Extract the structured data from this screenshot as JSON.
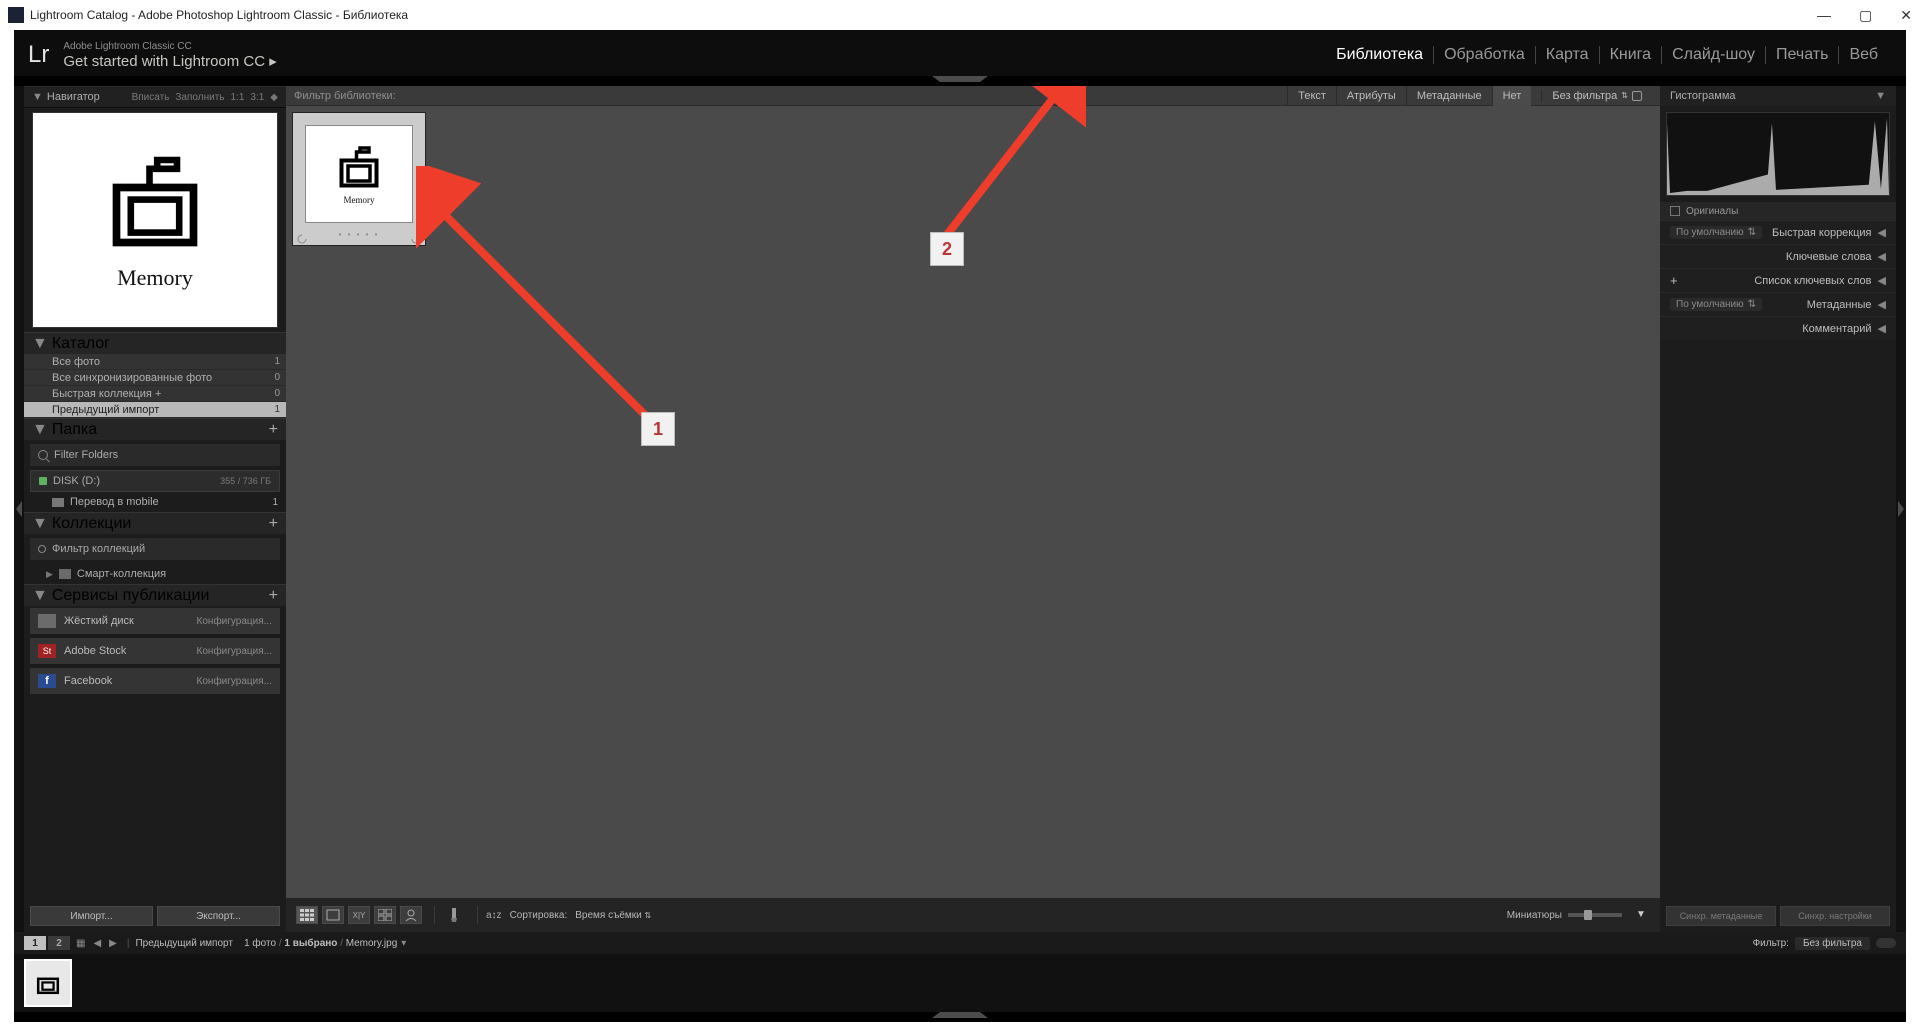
{
  "window": {
    "title": "Lightroom Catalog - Adobe Photoshop Lightroom Classic - Библиотека"
  },
  "header": {
    "logo": "Lr",
    "line1": "Adobe Lightroom Classic CC",
    "line2": "Get started with Lightroom CC ▸"
  },
  "modules": [
    "Библиотека",
    "Обработка",
    "Карта",
    "Книга",
    "Слайд-шоу",
    "Печать",
    "Веб"
  ],
  "modules_active": 0,
  "navigator": {
    "title": "Навигатор",
    "zoom_opts": [
      "Вписать",
      "Заполнить",
      "1:1",
      "3:1"
    ],
    "preview_label": "Memory"
  },
  "catalog": {
    "title": "Каталог",
    "items": [
      {
        "label": "Все фото",
        "count": "1"
      },
      {
        "label": "Все синхронизированные фото",
        "count": "0"
      },
      {
        "label": "Быстрая коллекция  +",
        "count": "0"
      },
      {
        "label": "Предыдущий импорт",
        "count": "1",
        "selected": true
      }
    ]
  },
  "folders": {
    "title": "Папка",
    "filter_placeholder": "Filter Folders",
    "disk": {
      "name": "DISK (D:)",
      "capacity": "355 / 736 ГБ"
    },
    "items": [
      {
        "label": "Перевод в mobile",
        "count": "1"
      }
    ]
  },
  "collections": {
    "title": "Коллекции",
    "filter_placeholder": "Фильтр коллекций",
    "smart": "Смарт-коллекция"
  },
  "publish": {
    "title": "Сервисы публикации",
    "items": [
      {
        "name": "Жёсткий диск",
        "icon_bg": "#6b6b6b",
        "conf": "Конфигурация..."
      },
      {
        "name": "Adobe Stock",
        "icon_bg": "#a02222",
        "icon_text": "St",
        "conf": "Конфигурация..."
      },
      {
        "name": "Facebook",
        "icon_bg": "#2a4b8d",
        "icon_text": "f",
        "conf": "Конфигурация..."
      }
    ]
  },
  "left_buttons": {
    "import": "Импорт...",
    "export": "Экспорт..."
  },
  "filter_bar": {
    "label": "Фильтр библиотеки:",
    "tabs": [
      "Текст",
      "Атрибуты",
      "Метаданные",
      "Нет"
    ],
    "active_tab": 3,
    "nofilter": "Без фильтра"
  },
  "thumb": {
    "label": "Memory"
  },
  "annotations": {
    "a1": "1",
    "a2": "2"
  },
  "toolbar": {
    "sort_label": "Сортировка:",
    "sort_value": "Время съёмки",
    "thumbs_label": "Миниатюры"
  },
  "right_panel": {
    "histogram": "Гистограмма",
    "originals": "Оригиналы",
    "default_dd": "По умолчанию",
    "quick_dev": "Быстрая коррекция",
    "keywords": "Ключевые слова",
    "keyword_list": "Список ключевых слов",
    "metadata": "Метаданные",
    "comments": "Комментарий",
    "sync_meta": "Синхр. метаданные",
    "sync_settings": "Синхр. настройки"
  },
  "status": {
    "page1": "1",
    "page2": "2",
    "breadcrumb": "Предыдущий импорт",
    "count_label": "1 фото",
    "selected_label": "1 выбрано",
    "filename": "Memory.jpg",
    "filter_label": "Фильтр:",
    "filter_value": "Без фильтра"
  }
}
